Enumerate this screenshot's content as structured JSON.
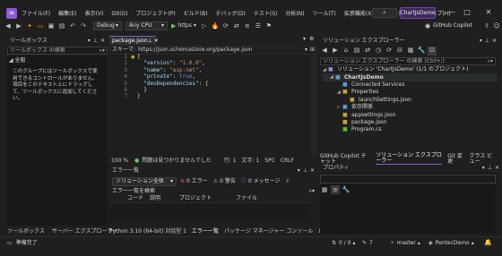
{
  "app": {
    "menu": [
      "ファイル(F)",
      "編集(E)",
      "表示(V)",
      "Git(G)",
      "プロジェクト(P)",
      "ビルド(B)",
      "デバッグ(D)",
      "テスト(S)",
      "分析(N)",
      "ツール(T)",
      "拡張機能(X)",
      "ウィンドウ(W)",
      "ヘルプ(H)"
    ],
    "search_icon": "search-icon",
    "solution_name": "ChartJsDemo",
    "window_controls": {
      "minimize": "—",
      "maximize": "□",
      "close": "✕"
    }
  },
  "toolbar": {
    "config": "Debug",
    "platform": "Any CPU",
    "run_label": "https",
    "copilot_label": "GitHub Copilot"
  },
  "toolbox": {
    "title": "ツールボックス",
    "search_placeholder": "ツールボックス の検索",
    "group": "◢ 全般",
    "message": "このグループにはツールボックスで使用できるコントロールがありません。項目をこのテキスト上にドラッグして、ツールボックスに追加してください。",
    "tabs": [
      "ツールボックス",
      "サーバー エクスプローラー"
    ]
  },
  "editor": {
    "tab_label": "package.json",
    "schema_label": "スキーマ:",
    "schema_url": "https://json.schemastore.org/package.json",
    "line_numbers": [
      "1",
      "2",
      "3",
      "4",
      "5",
      "6",
      "7"
    ],
    "code": [
      [
        "{"
      ],
      [
        "  \"version\"",
        ": ",
        "\"1.0.0\"",
        ","
      ],
      [
        "  \"name\"",
        ": ",
        "\"asp.net\"",
        ","
      ],
      [
        "  \"private\"",
        ": ",
        "true",
        ","
      ],
      [
        "  \"devDependencies\"",
        ": {",
        "",
        ""
      ],
      [
        "  }"
      ],
      [
        "}"
      ]
    ],
    "status": {
      "zoom": "100 %",
      "issues": "問題は見つかりませんでした",
      "line": "行: 1",
      "col": "文字: 1",
      "spc": "SPC",
      "eol": "CRLF"
    }
  },
  "errors": {
    "title": "エラー一覧",
    "scope": "ソリューション全体",
    "errors_label": "0 エラー",
    "warnings_label": "0 警告",
    "messages_label": "0 メッセージ",
    "search_label": "エラー一覧を検索",
    "columns": [
      "",
      "コード",
      "説明",
      "プロジェクト",
      "ファイル"
    ],
    "bottom_tabs": [
      "Python 3.10 (64-bit) 対話型 1",
      "エラー一覧",
      "パッケージ マネージャー コンソール",
      "出力"
    ]
  },
  "solution_explorer": {
    "title": "ソリューション エクスプローラー",
    "search_placeholder": "ソリューション エクスプローラー の検索 (Ctrl+;)",
    "tree": [
      {
        "label": "ソリューション 'ChartJsDemo' (1/1 のプロジェクト)",
        "indent": 0,
        "icon": "solution-icon",
        "icon_color": "#9b7fd4"
      },
      {
        "label": "ChartJsDemo",
        "indent": 1,
        "icon": "project-icon",
        "icon_color": "#5a9bd5",
        "bold": true
      },
      {
        "label": "Connected Services",
        "indent": 2,
        "icon": "connected-services-icon",
        "icon_color": "#5a9bd5"
      },
      {
        "label": "Properties",
        "indent": 2,
        "icon": "wrench-icon",
        "icon_color": "#c9a227"
      },
      {
        "label": "launchSettings.json",
        "indent": 3,
        "icon": "json-file-icon",
        "icon_color": "#c9a227"
      },
      {
        "label": "依存関係",
        "indent": 2,
        "icon": "dependencies-icon",
        "icon_color": "#5a9bd5"
      },
      {
        "label": "appsettings.json",
        "indent": 2,
        "icon": "json-file-icon",
        "icon_color": "#c9a227"
      },
      {
        "label": "package.json",
        "indent": 2,
        "icon": "json-file-icon",
        "icon_color": "#c9a227"
      },
      {
        "label": "Program.cs",
        "indent": 2,
        "icon": "csharp-file-icon",
        "icon_color": "#68b723"
      }
    ],
    "tabs": [
      "GitHub Copilot チャット",
      "ソリューション エクスプローラー",
      "Git 変更",
      "クラス ビュー"
    ]
  },
  "properties": {
    "title": "プロパティ"
  },
  "statusbar": {
    "ready": "準備完了",
    "changes": "0 / 0 ▴",
    "pencil_count": "7",
    "branch": "master",
    "repo": "PentecDemo",
    "accent": "#8a5bd6"
  }
}
